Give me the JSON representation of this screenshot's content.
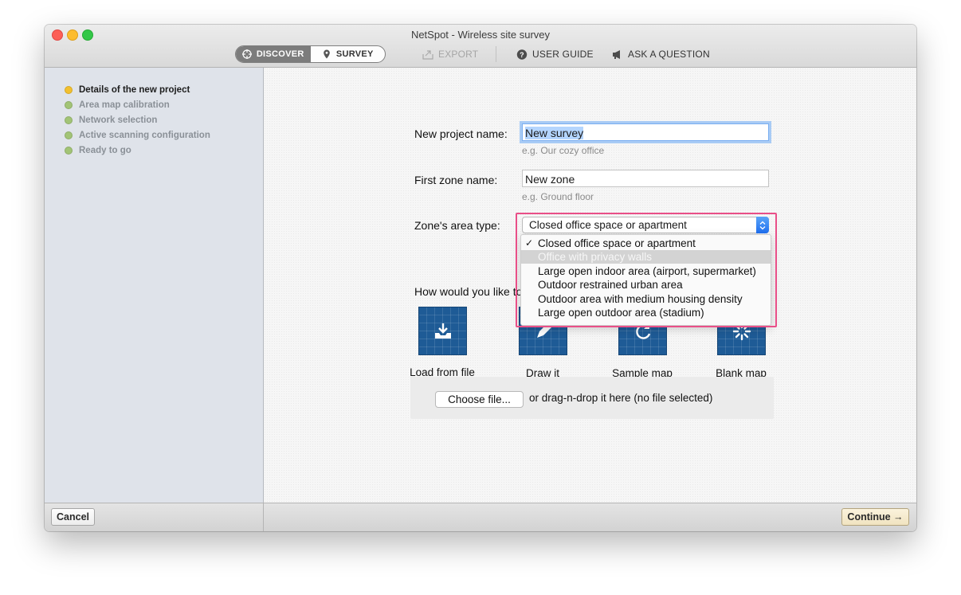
{
  "window": {
    "title": "NetSpot - Wireless site survey"
  },
  "toolbar": {
    "discover_label": "DISCOVER",
    "survey_label": "SURVEY",
    "export_label": "EXPORT",
    "user_guide_label": "USER GUIDE",
    "ask_question_label": "ASK A QUESTION"
  },
  "sidebar": {
    "steps": [
      {
        "label": "Details of the new project",
        "state": "current"
      },
      {
        "label": "Area map calibration",
        "state": "pending"
      },
      {
        "label": "Network selection",
        "state": "pending"
      },
      {
        "label": "Active scanning configuration",
        "state": "pending"
      },
      {
        "label": "Ready to go",
        "state": "pending"
      }
    ]
  },
  "form": {
    "project_name_label": "New project name:",
    "project_name_value": "New survey",
    "project_name_hint": "e.g. Our cozy office",
    "zone_name_label": "First zone name:",
    "zone_name_value": "New zone",
    "zone_name_hint": "e.g. Ground floor",
    "area_type_label": "Zone's area type:",
    "area_type_selected": "Closed office space or apartment",
    "area_type_options": [
      "Closed office space or apartment",
      "Office with privacy walls",
      "Large open indoor area (airport, supermarket)",
      "Outdoor restrained urban area",
      "Outdoor area with medium housing density",
      "Large open outdoor area (stadium)"
    ],
    "map_question": "How would you like to",
    "map_choices": [
      {
        "label": "Load from file",
        "icon": "download-tray-icon",
        "selected": true
      },
      {
        "label": "Draw it",
        "icon": "pencil-icon",
        "selected": false
      },
      {
        "label": "Sample map",
        "icon": "refresh-icon",
        "selected": false
      },
      {
        "label": "Blank map",
        "icon": "spinner-icon",
        "selected": false
      }
    ],
    "choose_file_label": "Choose file...",
    "drop_text": "or drag-n-drop it here (no file selected)"
  },
  "footer": {
    "cancel_label": "Cancel",
    "continue_label": "Continue →"
  },
  "colors": {
    "accent": "#3b8cf5",
    "highlight_frame": "#e94f88",
    "step_done": "#a2c476",
    "step_current": "#f2c02f",
    "map_icon_bg": "#1e5b96"
  }
}
